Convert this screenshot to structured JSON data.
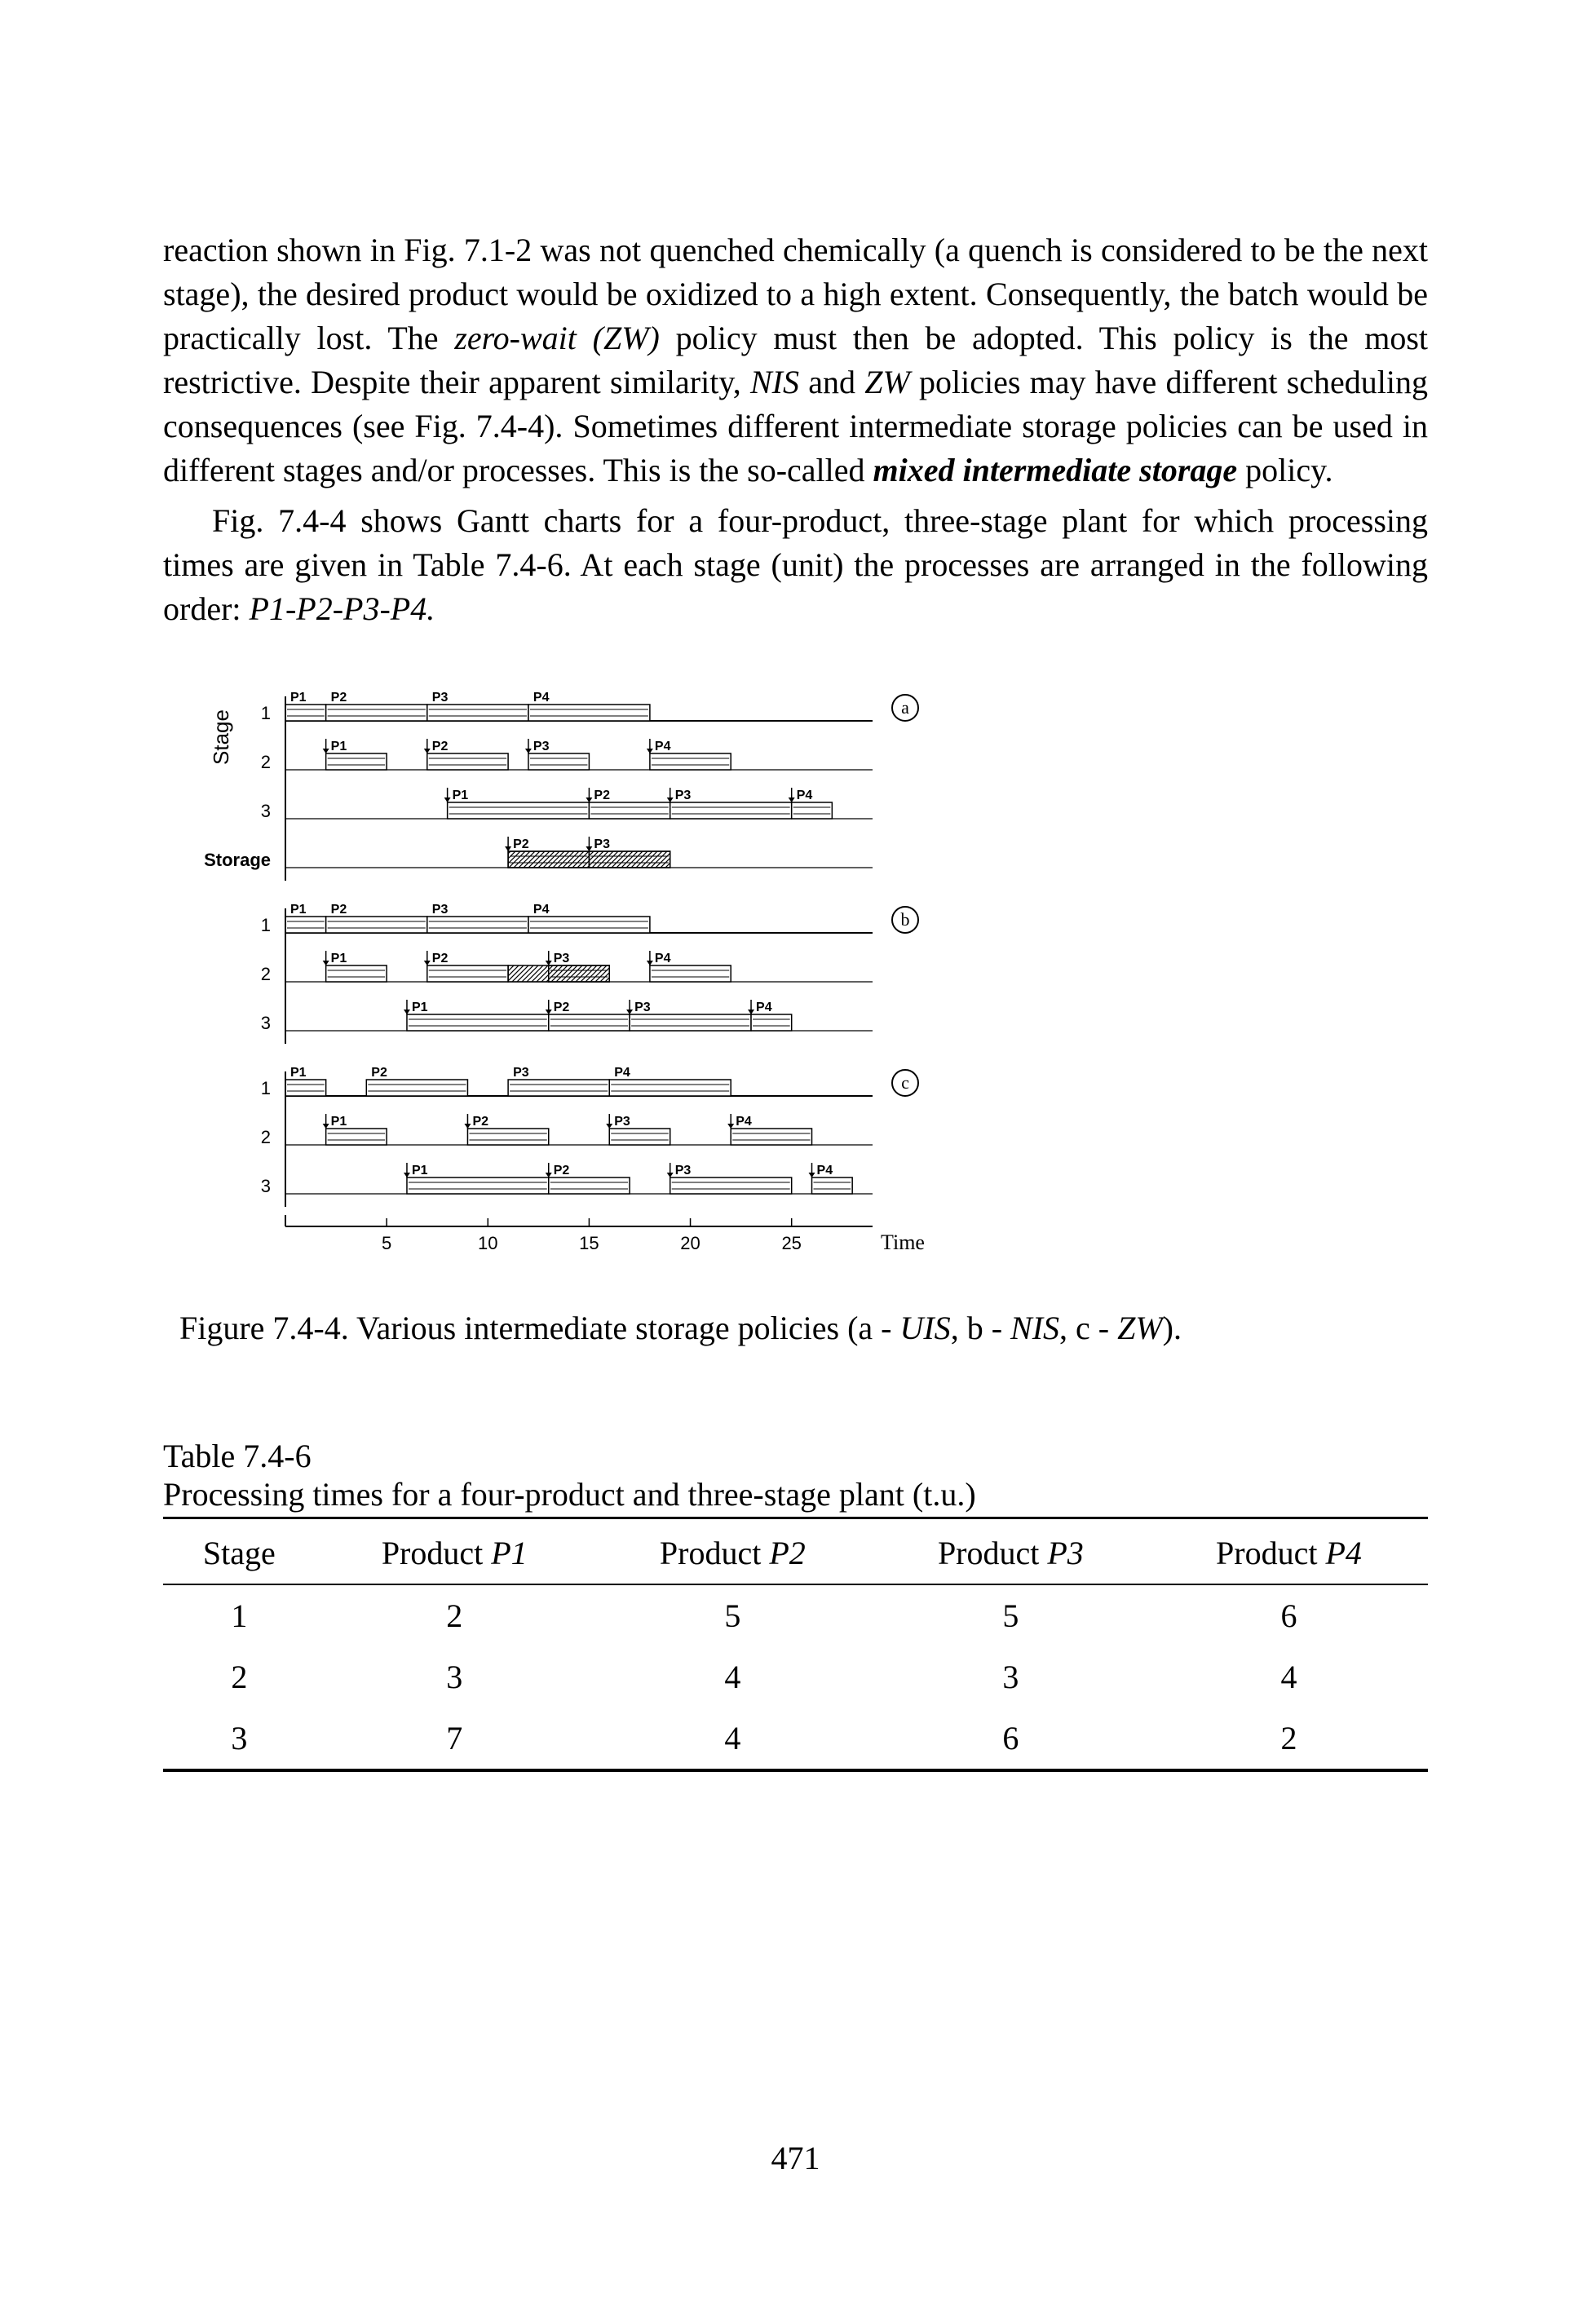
{
  "paragraphs": {
    "p1_a": "reaction shown in Fig. 7.1-2 was not quenched chemically (a quench is considered to be the next stage), the desired product would be oxidized to a high extent. Consequently, the batch would be practically lost. The ",
    "p1_i1": "zero-wait (ZW)",
    "p1_b": " policy must then be adopted. This policy is the most restrictive. Despite their apparent similarity, ",
    "p1_i2": "NIS",
    "p1_c": " and ",
    "p1_i3": "ZW",
    "p1_d": " policies may have different scheduling consequences (see Fig. 7.4-4). Sometimes different intermediate storage policies can be used in different stages and/or processes. This is the so-called ",
    "p1_bi": "mixed intermediate storage",
    "p1_e": " policy.",
    "p2_a": "Fig. 7.4-4 shows Gantt charts for a four-product, three-stage plant for which processing times are given in Table 7.4-6. At each stage (unit) the processes are arranged in the following order: ",
    "p2_i1": "P1-P2-P3-P4.",
    "p2_b": ""
  },
  "chart_data": [
    {
      "type": "gantt",
      "label": "a",
      "policy": "UIS",
      "ylabel": "Stage",
      "stages": [
        {
          "stage": 1,
          "bars": [
            {
              "name": "P1",
              "start": 0,
              "end": 2
            },
            {
              "name": "P2",
              "start": 2,
              "end": 7
            },
            {
              "name": "P3",
              "start": 7,
              "end": 12
            },
            {
              "name": "P4",
              "start": 12,
              "end": 18
            }
          ]
        },
        {
          "stage": 2,
          "bars": [
            {
              "name": "P1",
              "start": 2,
              "end": 5
            },
            {
              "name": "P2",
              "start": 7,
              "end": 11
            },
            {
              "name": "P3",
              "start": 12,
              "end": 15
            },
            {
              "name": "P4",
              "start": 18,
              "end": 22
            }
          ]
        },
        {
          "stage": 3,
          "bars": [
            {
              "name": "P1",
              "start": 8,
              "end": 15
            },
            {
              "name": "P2",
              "start": 15,
              "end": 19
            },
            {
              "name": "P3",
              "start": 19,
              "end": 25
            },
            {
              "name": "P4",
              "start": 25,
              "end": 27
            }
          ]
        },
        {
          "stage": "Storage",
          "bars": [
            {
              "name": "P2",
              "start": 11,
              "end": 15,
              "hatched": true
            },
            {
              "name": "P3",
              "start": 15,
              "end": 19,
              "hatched": true
            }
          ]
        }
      ],
      "xlim": [
        0,
        28
      ]
    },
    {
      "type": "gantt",
      "label": "b",
      "policy": "NIS",
      "stages": [
        {
          "stage": 1,
          "bars": [
            {
              "name": "P1",
              "start": 0,
              "end": 2
            },
            {
              "name": "P2",
              "start": 2,
              "end": 7
            },
            {
              "name": "P3",
              "start": 7,
              "end": 12
            },
            {
              "name": "P4",
              "start": 12,
              "end": 18
            }
          ]
        },
        {
          "stage": 2,
          "bars": [
            {
              "name": "P1",
              "start": 2,
              "end": 5
            },
            {
              "name": "P2",
              "start": 7,
              "end": 11,
              "hold_to": 13
            },
            {
              "name": "P3",
              "start": 13,
              "end": 16,
              "hatched_lead": true
            },
            {
              "name": "P4",
              "start": 18,
              "end": 22
            }
          ]
        },
        {
          "stage": 3,
          "bars": [
            {
              "name": "P1",
              "start": 6,
              "end": 13
            },
            {
              "name": "P2",
              "start": 13,
              "end": 17
            },
            {
              "name": "P3",
              "start": 17,
              "end": 23
            },
            {
              "name": "P4",
              "start": 23,
              "end": 25
            }
          ]
        }
      ],
      "xlim": [
        0,
        28
      ]
    },
    {
      "type": "gantt",
      "label": "c",
      "policy": "ZW",
      "stages": [
        {
          "stage": 1,
          "bars": [
            {
              "name": "P1",
              "start": 0,
              "end": 2
            },
            {
              "name": "P2",
              "start": 4,
              "end": 9
            },
            {
              "name": "P3",
              "start": 11,
              "end": 16
            },
            {
              "name": "P4",
              "start": 16,
              "end": 22
            }
          ]
        },
        {
          "stage": 2,
          "bars": [
            {
              "name": "P1",
              "start": 2,
              "end": 5
            },
            {
              "name": "P2",
              "start": 9,
              "end": 13
            },
            {
              "name": "P3",
              "start": 16,
              "end": 19
            },
            {
              "name": "P4",
              "start": 22,
              "end": 26
            }
          ]
        },
        {
          "stage": 3,
          "bars": [
            {
              "name": "P1",
              "start": 6,
              "end": 13
            },
            {
              "name": "P2",
              "start": 13,
              "end": 17
            },
            {
              "name": "P3",
              "start": 19,
              "end": 25
            },
            {
              "name": "P4",
              "start": 26,
              "end": 28
            }
          ]
        }
      ],
      "xlim": [
        0,
        29
      ]
    }
  ],
  "figure": {
    "x_ticks": [
      5,
      10,
      15,
      20,
      25
    ],
    "x_axis_label": "Time",
    "storage_label": "Storage",
    "caption_a": "Figure 7.4-4. Various intermediate storage policies (a - ",
    "caption_i1": "UIS",
    "caption_b": ", b - ",
    "caption_i2": "NIS",
    "caption_c": ", c - ",
    "caption_i3": "ZW",
    "caption_d": ")."
  },
  "table": {
    "title": "Table 7.4-6",
    "subtitle": "Processing times for a four-product and three-stage plant (t.u.)",
    "headers": [
      "Stage",
      "Product P1",
      "Product P2",
      "Product P3",
      "Product P4"
    ],
    "rows": [
      [
        "1",
        "2",
        "5",
        "5",
        "6"
      ],
      [
        "2",
        "3",
        "4",
        "3",
        "4"
      ],
      [
        "3",
        "7",
        "4",
        "6",
        "2"
      ]
    ]
  },
  "page_number": "471"
}
